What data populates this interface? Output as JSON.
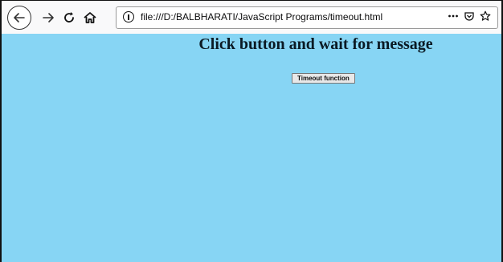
{
  "browser": {
    "url": "file:///D:/BALBHARATI/JavaScript Programs/timeout.html",
    "icons": {
      "back": "back-arrow-icon",
      "forward": "forward-arrow-icon",
      "reload": "reload-icon",
      "home": "home-icon",
      "site_info": "info-icon",
      "page_actions": "more-icon",
      "pocket": "pocket-icon",
      "bookmark": "star-icon"
    }
  },
  "page": {
    "heading": "Click button and wait for message",
    "button_label": "Timeout function",
    "background_color": "#87d5f4"
  }
}
